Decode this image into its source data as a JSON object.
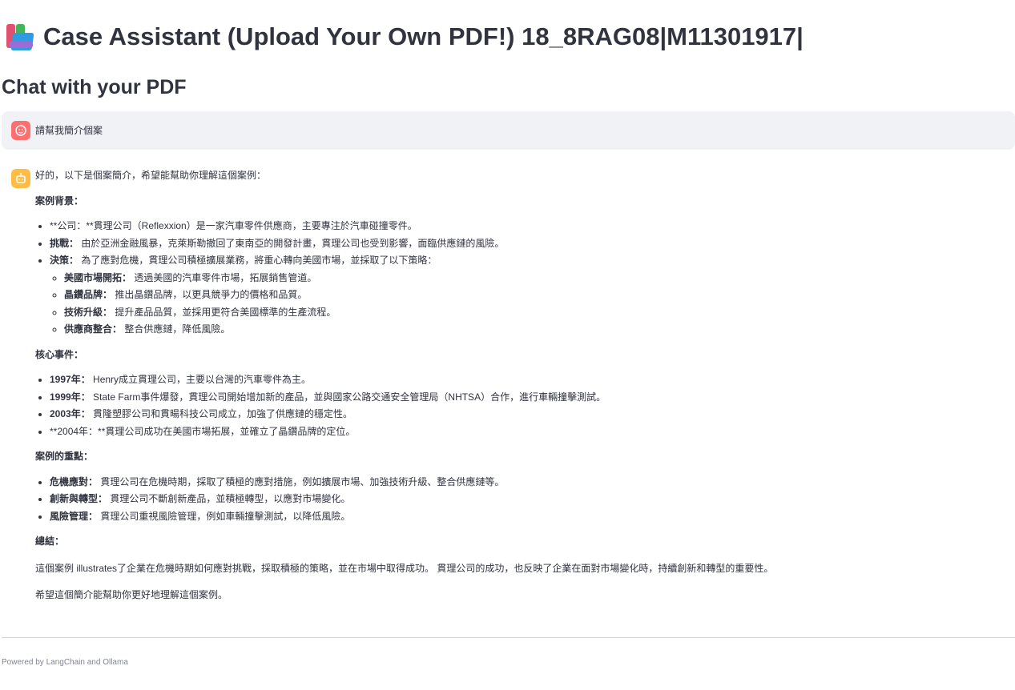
{
  "header": {
    "title": "Case Assistant (Upload Your Own PDF!) 18_8RAG08|M11301917|",
    "title_icon": "books-icon",
    "subtitle": "Chat with your PDF"
  },
  "colors": {
    "user_avatar": "#ff6f6f",
    "assistant_avatar": "#ffbd45",
    "user_bubble": "#f0f2f6",
    "text": "#31333f",
    "footer_text": "#808495"
  },
  "chat": {
    "user_message": {
      "avatar_icon": "user-face-icon",
      "text": "請幫我簡介個案"
    },
    "assistant_message": {
      "avatar_icon": "bot-icon",
      "intro": "好的，以下是個案簡介，希望能幫助你理解這個案例：",
      "section_background": {
        "heading": "案例背景：",
        "item1_text": "**公司：**貫理公司（Reflexxion）是一家汽車零件供應商，主要專注於汽車碰撞零件。",
        "item2_label": "挑戰：",
        "item2_text": "由於亞洲金融風暴，克萊斯勒撤回了東南亞的開發計畫，貫理公司也受到影響，面臨供應鏈的風險。",
        "item3_label": "決策：",
        "item3_text": "為了應對危機，貫理公司積極擴展業務，將重心轉向美國市場，並採取了以下策略：",
        "sub1_label": "美國市場開拓：",
        "sub1_text": "透過美國的汽車零件市場，拓展銷售管道。",
        "sub2_label": "晶鑽品牌：",
        "sub2_text": "推出晶鑽品牌，以更具競爭力的價格和品質。",
        "sub3_label": "技術升級：",
        "sub3_text": "提升產品品質，並採用更符合美國標準的生產流程。",
        "sub4_label": "供應商整合：",
        "sub4_text": "整合供應鏈，降低風險。"
      },
      "section_events": {
        "heading": "核心事件：",
        "item1_label": "1997年：",
        "item1_text": "Henry成立貫理公司，主要以台灣的汽車零件為主。",
        "item2_label": "1999年：",
        "item2_text": "State Farm事件爆發，貫理公司開始增加新的產品，並與國家公路交通安全管理局（NHTSA）合作，進行車輛撞擊測試。",
        "item3_label": "2003年：",
        "item3_text": "貫隆塑膠公司和貫暘科技公司成立，加強了供應鏈的穩定性。",
        "item4_text": "**2004年：**貫理公司成功在美國市場拓展，並確立了晶鑽品牌的定位。"
      },
      "section_focus": {
        "heading": "案例的重點：",
        "item1_label": "危機應對：",
        "item1_text": "貫理公司在危機時期，採取了積極的應對措施，例如擴展市場、加強技術升級、整合供應鏈等。",
        "item2_label": "創新與轉型：",
        "item2_text": "貫理公司不斷創新產品，並積極轉型，以應對市場變化。",
        "item3_label": "風險管理：",
        "item3_text": "貫理公司重視風險管理，例如車輛撞擊測試，以降低風險。"
      },
      "section_summary": {
        "heading": "總結：",
        "text": "這個案例 illustrates了企業在危機時期如何應對挑戰，採取積極的策略，並在市場中取得成功。 貫理公司的成功，也反映了企業在面對市場變化時，持續創新和轉型的重要性。"
      },
      "closing": "希望這個簡介能幫助你更好地理解這個案例。"
    }
  },
  "footer": {
    "text": "Powered by LangChain and Ollama"
  }
}
